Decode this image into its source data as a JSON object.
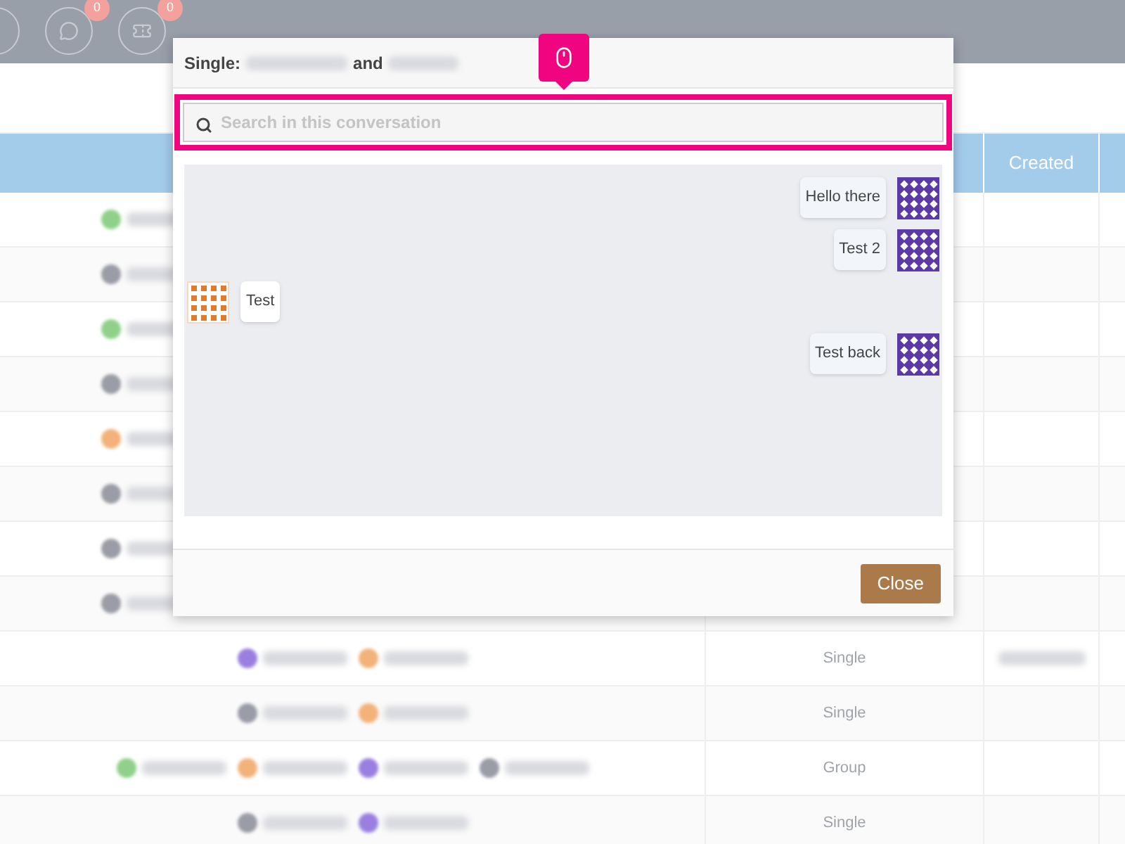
{
  "top_bar": {
    "icons": [
      {
        "kind": "partial"
      },
      {
        "kind": "chat",
        "badge": "0"
      },
      {
        "kind": "ticket",
        "badge": "0"
      }
    ]
  },
  "table": {
    "columns": [
      {},
      {},
      {
        "label": "Created"
      }
    ],
    "rows": [
      {
        "kind": "covered",
        "chips": [
          {
            "color": "#8fd18a"
          }
        ]
      },
      {
        "kind": "covered",
        "chips": [
          {
            "color": "#9a9ca6"
          }
        ]
      },
      {
        "kind": "covered",
        "chips": [
          {
            "color": "#8fd18a"
          }
        ]
      },
      {
        "kind": "covered",
        "chips": [
          {
            "color": "#9a9ca6"
          }
        ]
      },
      {
        "kind": "covered",
        "chips": [
          {
            "color": "#f2b27a"
          }
        ]
      },
      {
        "kind": "covered",
        "chips": [
          {
            "color": "#9a9ca6"
          }
        ]
      },
      {
        "kind": "covered",
        "chips": [
          {
            "color": "#9a9ca6"
          }
        ]
      },
      {
        "kind": "covered",
        "chips": [
          {
            "color": "#9a9ca6"
          }
        ]
      },
      {
        "chips": [
          {
            "color": "#9b7fe0"
          },
          {
            "color": "#f2b27a"
          }
        ],
        "type": "Single",
        "created": true
      },
      {
        "chips": [
          {
            "color": "#9a9ca6"
          },
          {
            "color": "#f2b27a"
          }
        ],
        "type": "Single"
      },
      {
        "chips": [
          {
            "color": "#8fd18a"
          },
          {
            "color": "#f2b27a"
          },
          {
            "color": "#9b7fe0"
          },
          {
            "color": "#9a9ca6"
          }
        ],
        "type": "Group"
      },
      {
        "chips": [
          {
            "color": "#9a9ca6"
          },
          {
            "color": "#9b7fe0"
          }
        ],
        "type": "Single"
      }
    ]
  },
  "dialog": {
    "title_prefix": "Single:",
    "joiner": "and",
    "search": {
      "placeholder": "Search in this conversation"
    },
    "messages": [
      {
        "kind": "sent",
        "text": "Hello there"
      },
      {
        "kind": "sent",
        "text": "Test 2"
      },
      {
        "kind": "received",
        "text": "Test"
      },
      {
        "kind": "sent",
        "text": "Test back"
      }
    ],
    "close_button": "Close"
  }
}
